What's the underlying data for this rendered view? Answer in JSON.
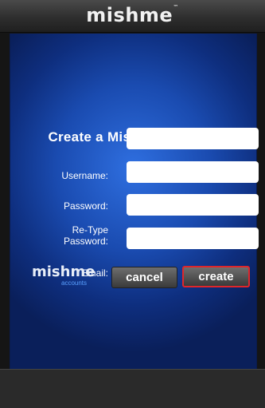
{
  "header": {
    "logo_text": "mishme"
  },
  "form": {
    "title": "Create a Mishme Account",
    "username_label": "Username:",
    "username_value": "",
    "password_label": "Password:",
    "password_value": "",
    "retype_label_line1": "Re-Type",
    "retype_label_line2": "Password:",
    "retype_value": "",
    "email_label": "Email:",
    "email_value": ""
  },
  "brand": {
    "name": "mishme",
    "sub": "accounts"
  },
  "actions": {
    "cancel_label": "cancel",
    "create_label": "create"
  },
  "colors": {
    "panel_blue": "#1a4bb0",
    "highlight_red": "#e0262a"
  }
}
